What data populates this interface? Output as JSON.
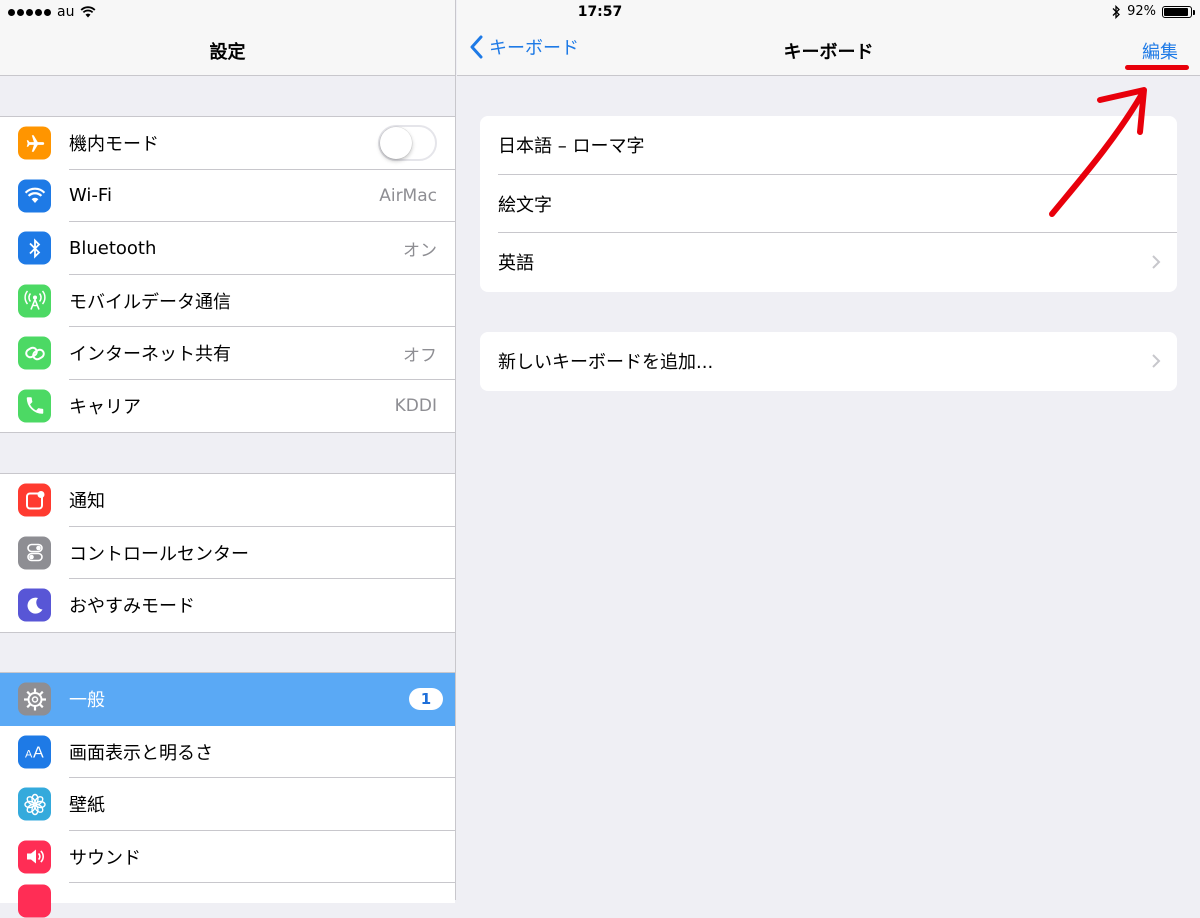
{
  "status_bar": {
    "carrier": "au",
    "time": "17:57",
    "battery_text": "92%",
    "battery_level": 0.92
  },
  "master": {
    "title": "設定",
    "groups": [
      {
        "items": [
          {
            "label": "機内モード",
            "icon": "airplane-icon",
            "color": "#ff9500",
            "accessory": "toggle",
            "toggle_on": false
          },
          {
            "label": "Wi-Fi",
            "icon": "wifi-icon",
            "color": "#1e7ae6",
            "value": "AirMac"
          },
          {
            "label": "Bluetooth",
            "icon": "bluetooth-icon",
            "color": "#1e7ae6",
            "value": "オン"
          },
          {
            "label": "モバイルデータ通信",
            "icon": "cellular-antenna-icon",
            "color": "#4cd964",
            "value": ""
          },
          {
            "label": "インターネット共有",
            "icon": "link-icon",
            "color": "#4cd964",
            "value": "オフ"
          },
          {
            "label": "キャリア",
            "icon": "phone-icon",
            "color": "#4cd964",
            "value": "KDDI"
          }
        ]
      },
      {
        "items": [
          {
            "label": "通知",
            "icon": "notifications-icon",
            "color": "#ff3b30"
          },
          {
            "label": "コントロールセンター",
            "icon": "control-center-icon",
            "color": "#8e8e93"
          },
          {
            "label": "おやすみモード",
            "icon": "moon-icon",
            "color": "#5856d6"
          }
        ]
      },
      {
        "items": [
          {
            "label": "一般",
            "icon": "gear-icon",
            "color": "#8e8e93",
            "badge": "1",
            "selected": true
          },
          {
            "label": "画面表示と明るさ",
            "icon": "text-size-icon",
            "color": "#1e7ae6"
          },
          {
            "label": "壁紙",
            "icon": "flower-icon",
            "color": "#34aadc"
          },
          {
            "label": "サウンド",
            "icon": "speaker-icon",
            "color": "#ff2d55"
          }
        ]
      }
    ]
  },
  "detail": {
    "back_label": "キーボード",
    "title": "キーボード",
    "edit_label": "編集",
    "sections": [
      {
        "rows": [
          {
            "label": "日本語 – ローマ字",
            "chevron": false
          },
          {
            "label": "絵文字",
            "chevron": false
          },
          {
            "label": "英語",
            "chevron": true
          }
        ]
      },
      {
        "rows": [
          {
            "label": "新しいキーボードを追加...",
            "chevron": true
          }
        ]
      }
    ]
  },
  "colors": {
    "ios_blue": "#1e7ae6",
    "selected_row": "#5aa9f5",
    "annotation_red": "#e8000b"
  }
}
